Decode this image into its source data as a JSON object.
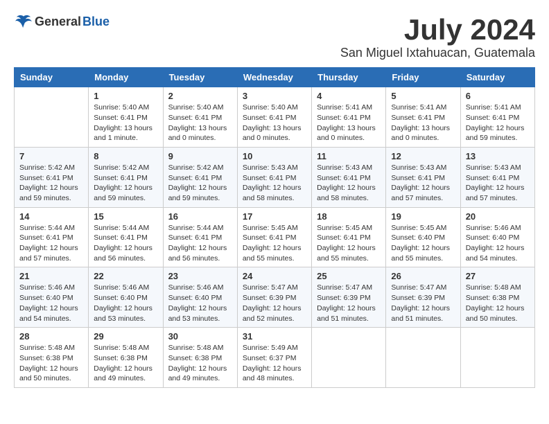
{
  "logo": {
    "general": "General",
    "blue": "Blue"
  },
  "title": "July 2024",
  "location": "San Miguel Ixtahuacan, Guatemala",
  "weekdays": [
    "Sunday",
    "Monday",
    "Tuesday",
    "Wednesday",
    "Thursday",
    "Friday",
    "Saturday"
  ],
  "weeks": [
    [
      {
        "day": "",
        "sunrise": "",
        "sunset": "",
        "daylight": ""
      },
      {
        "day": "1",
        "sunrise": "Sunrise: 5:40 AM",
        "sunset": "Sunset: 6:41 PM",
        "daylight": "Daylight: 13 hours and 1 minute."
      },
      {
        "day": "2",
        "sunrise": "Sunrise: 5:40 AM",
        "sunset": "Sunset: 6:41 PM",
        "daylight": "Daylight: 13 hours and 0 minutes."
      },
      {
        "day": "3",
        "sunrise": "Sunrise: 5:40 AM",
        "sunset": "Sunset: 6:41 PM",
        "daylight": "Daylight: 13 hours and 0 minutes."
      },
      {
        "day": "4",
        "sunrise": "Sunrise: 5:41 AM",
        "sunset": "Sunset: 6:41 PM",
        "daylight": "Daylight: 13 hours and 0 minutes."
      },
      {
        "day": "5",
        "sunrise": "Sunrise: 5:41 AM",
        "sunset": "Sunset: 6:41 PM",
        "daylight": "Daylight: 13 hours and 0 minutes."
      },
      {
        "day": "6",
        "sunrise": "Sunrise: 5:41 AM",
        "sunset": "Sunset: 6:41 PM",
        "daylight": "Daylight: 12 hours and 59 minutes."
      }
    ],
    [
      {
        "day": "7",
        "sunrise": "Sunrise: 5:42 AM",
        "sunset": "Sunset: 6:41 PM",
        "daylight": "Daylight: 12 hours and 59 minutes."
      },
      {
        "day": "8",
        "sunrise": "Sunrise: 5:42 AM",
        "sunset": "Sunset: 6:41 PM",
        "daylight": "Daylight: 12 hours and 59 minutes."
      },
      {
        "day": "9",
        "sunrise": "Sunrise: 5:42 AM",
        "sunset": "Sunset: 6:41 PM",
        "daylight": "Daylight: 12 hours and 59 minutes."
      },
      {
        "day": "10",
        "sunrise": "Sunrise: 5:43 AM",
        "sunset": "Sunset: 6:41 PM",
        "daylight": "Daylight: 12 hours and 58 minutes."
      },
      {
        "day": "11",
        "sunrise": "Sunrise: 5:43 AM",
        "sunset": "Sunset: 6:41 PM",
        "daylight": "Daylight: 12 hours and 58 minutes."
      },
      {
        "day": "12",
        "sunrise": "Sunrise: 5:43 AM",
        "sunset": "Sunset: 6:41 PM",
        "daylight": "Daylight: 12 hours and 57 minutes."
      },
      {
        "day": "13",
        "sunrise": "Sunrise: 5:43 AM",
        "sunset": "Sunset: 6:41 PM",
        "daylight": "Daylight: 12 hours and 57 minutes."
      }
    ],
    [
      {
        "day": "14",
        "sunrise": "Sunrise: 5:44 AM",
        "sunset": "Sunset: 6:41 PM",
        "daylight": "Daylight: 12 hours and 57 minutes."
      },
      {
        "day": "15",
        "sunrise": "Sunrise: 5:44 AM",
        "sunset": "Sunset: 6:41 PM",
        "daylight": "Daylight: 12 hours and 56 minutes."
      },
      {
        "day": "16",
        "sunrise": "Sunrise: 5:44 AM",
        "sunset": "Sunset: 6:41 PM",
        "daylight": "Daylight: 12 hours and 56 minutes."
      },
      {
        "day": "17",
        "sunrise": "Sunrise: 5:45 AM",
        "sunset": "Sunset: 6:41 PM",
        "daylight": "Daylight: 12 hours and 55 minutes."
      },
      {
        "day": "18",
        "sunrise": "Sunrise: 5:45 AM",
        "sunset": "Sunset: 6:41 PM",
        "daylight": "Daylight: 12 hours and 55 minutes."
      },
      {
        "day": "19",
        "sunrise": "Sunrise: 5:45 AM",
        "sunset": "Sunset: 6:40 PM",
        "daylight": "Daylight: 12 hours and 55 minutes."
      },
      {
        "day": "20",
        "sunrise": "Sunrise: 5:46 AM",
        "sunset": "Sunset: 6:40 PM",
        "daylight": "Daylight: 12 hours and 54 minutes."
      }
    ],
    [
      {
        "day": "21",
        "sunrise": "Sunrise: 5:46 AM",
        "sunset": "Sunset: 6:40 PM",
        "daylight": "Daylight: 12 hours and 54 minutes."
      },
      {
        "day": "22",
        "sunrise": "Sunrise: 5:46 AM",
        "sunset": "Sunset: 6:40 PM",
        "daylight": "Daylight: 12 hours and 53 minutes."
      },
      {
        "day": "23",
        "sunrise": "Sunrise: 5:46 AM",
        "sunset": "Sunset: 6:40 PM",
        "daylight": "Daylight: 12 hours and 53 minutes."
      },
      {
        "day": "24",
        "sunrise": "Sunrise: 5:47 AM",
        "sunset": "Sunset: 6:39 PM",
        "daylight": "Daylight: 12 hours and 52 minutes."
      },
      {
        "day": "25",
        "sunrise": "Sunrise: 5:47 AM",
        "sunset": "Sunset: 6:39 PM",
        "daylight": "Daylight: 12 hours and 51 minutes."
      },
      {
        "day": "26",
        "sunrise": "Sunrise: 5:47 AM",
        "sunset": "Sunset: 6:39 PM",
        "daylight": "Daylight: 12 hours and 51 minutes."
      },
      {
        "day": "27",
        "sunrise": "Sunrise: 5:48 AM",
        "sunset": "Sunset: 6:38 PM",
        "daylight": "Daylight: 12 hours and 50 minutes."
      }
    ],
    [
      {
        "day": "28",
        "sunrise": "Sunrise: 5:48 AM",
        "sunset": "Sunset: 6:38 PM",
        "daylight": "Daylight: 12 hours and 50 minutes."
      },
      {
        "day": "29",
        "sunrise": "Sunrise: 5:48 AM",
        "sunset": "Sunset: 6:38 PM",
        "daylight": "Daylight: 12 hours and 49 minutes."
      },
      {
        "day": "30",
        "sunrise": "Sunrise: 5:48 AM",
        "sunset": "Sunset: 6:38 PM",
        "daylight": "Daylight: 12 hours and 49 minutes."
      },
      {
        "day": "31",
        "sunrise": "Sunrise: 5:49 AM",
        "sunset": "Sunset: 6:37 PM",
        "daylight": "Daylight: 12 hours and 48 minutes."
      },
      {
        "day": "",
        "sunrise": "",
        "sunset": "",
        "daylight": ""
      },
      {
        "day": "",
        "sunrise": "",
        "sunset": "",
        "daylight": ""
      },
      {
        "day": "",
        "sunrise": "",
        "sunset": "",
        "daylight": ""
      }
    ]
  ]
}
